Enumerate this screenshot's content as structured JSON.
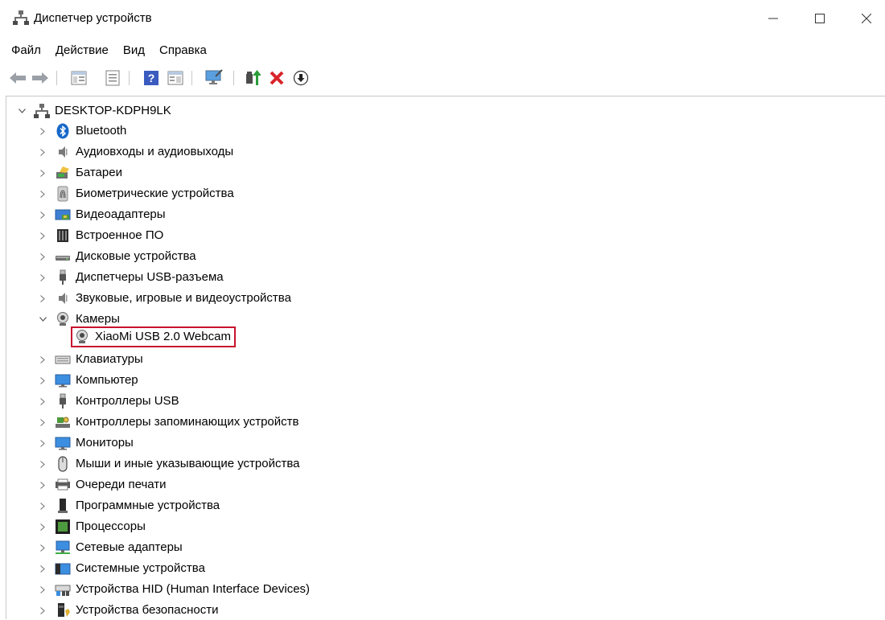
{
  "window": {
    "title": "Диспетчер устройств"
  },
  "menu": {
    "file": "Файл",
    "action": "Действие",
    "view": "Вид",
    "help": "Справка"
  },
  "tree": {
    "root": "DESKTOP-KDPH9LK",
    "categories": [
      {
        "label": "Bluetooth",
        "icon": "bluetooth-icon"
      },
      {
        "label": "Аудиовходы и аудиовыходы",
        "icon": "speaker-icon"
      },
      {
        "label": "Батареи",
        "icon": "battery-icon"
      },
      {
        "label": "Биометрические устройства",
        "icon": "fingerprint-icon"
      },
      {
        "label": "Видеоадаптеры",
        "icon": "display-adapter-icon"
      },
      {
        "label": "Встроенное ПО",
        "icon": "firmware-icon"
      },
      {
        "label": "Дисковые устройства",
        "icon": "disk-drive-icon"
      },
      {
        "label": "Диспетчеры USB-разъема",
        "icon": "usb-plug-icon"
      },
      {
        "label": "Звуковые, игровые и видеоустройства",
        "icon": "speaker-icon"
      },
      {
        "label": "Камеры",
        "icon": "webcam-icon",
        "expanded": true,
        "children": [
          {
            "label": "XiaoMi USB 2.0 Webcam",
            "icon": "webcam-icon"
          }
        ]
      },
      {
        "label": "Клавиатуры",
        "icon": "keyboard-icon"
      },
      {
        "label": "Компьютер",
        "icon": "monitor-icon"
      },
      {
        "label": "Контроллеры USB",
        "icon": "usb-plug-icon"
      },
      {
        "label": "Контроллеры запоминающих устройств",
        "icon": "storage-controller-icon"
      },
      {
        "label": "Мониторы",
        "icon": "monitor-icon"
      },
      {
        "label": "Мыши и иные указывающие устройства",
        "icon": "mouse-icon"
      },
      {
        "label": "Очереди печати",
        "icon": "printer-icon"
      },
      {
        "label": "Программные устройства",
        "icon": "software-device-icon"
      },
      {
        "label": "Процессоры",
        "icon": "processor-icon"
      },
      {
        "label": "Сетевые адаптеры",
        "icon": "network-adapter-icon"
      },
      {
        "label": "Системные устройства",
        "icon": "system-devices-icon"
      },
      {
        "label": "Устройства HID (Human Interface Devices)",
        "icon": "hid-icon"
      },
      {
        "label": "Устройства безопасности",
        "icon": "security-device-icon"
      }
    ]
  },
  "colors": {
    "highlight_border": "#c8102e",
    "remove_red": "#d9242b"
  }
}
